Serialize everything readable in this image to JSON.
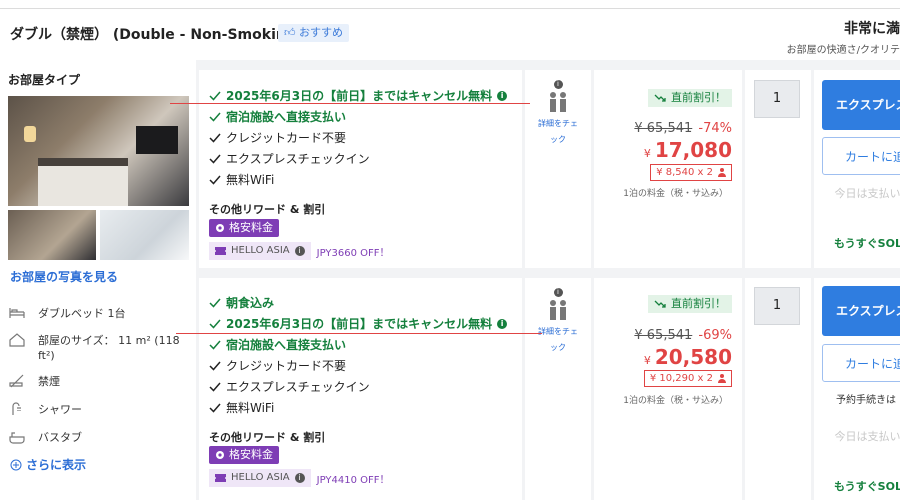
{
  "room": {
    "title": "ダブル（禁煙） (Double - Non-Smoking)",
    "badge": "おすすめ"
  },
  "header_right": {
    "heading": "非常に満",
    "subtitle": "お部屋の快適さ/クオリテ"
  },
  "left_panel": {
    "title": "お部屋タイプ",
    "photos_link": "お部屋の写真を見る",
    "amenities": [
      {
        "icon": "bed-icon",
        "text": "ダブルベッド 1台"
      },
      {
        "icon": "room-size-icon",
        "text": "部屋のサイズ： 11 m² (118 ft²)"
      },
      {
        "icon": "no-smoking-icon",
        "text": "禁煙"
      },
      {
        "icon": "shower-icon",
        "text": "シャワー"
      },
      {
        "icon": "bathtub-icon",
        "text": "バスタブ"
      }
    ],
    "more_link": "さらに表示"
  },
  "offers": [
    {
      "features": [
        {
          "text": "2025年6月3日の【前日】まではキャンセル無料",
          "green": true,
          "info": true
        },
        {
          "text": "宿泊施設へ直接支払い",
          "green": true,
          "info": false
        },
        {
          "text": "クレジットカード不要",
          "green": false,
          "info": false
        },
        {
          "text": "エクスプレスチェックイン",
          "green": false,
          "info": false
        },
        {
          "text": "無料WiFi",
          "green": false,
          "info": false
        }
      ],
      "rewards_title": "その他リワード & 割引",
      "tag": "格安料金",
      "promo_name": "HELLO ASIA",
      "promo_discount": "JPY3660 OFF！",
      "details_link": "詳細をチェック",
      "deal_badge": "直前割引！",
      "original_price": "¥ 65,541",
      "discount_pct": "-74%",
      "currency": "¥",
      "price": "17,080",
      "per_night": "¥ 8,540 x 2",
      "price_note": "1泊の料金（税・サ込み）",
      "quantity": "1",
      "express_button": "エクスプレス",
      "cart_button": "カートに追",
      "pre_note": "",
      "no_payment": "今日は支払い要",
      "sold_out_soon": "もうすぐSOL"
    },
    {
      "features": [
        {
          "text": "朝食込み",
          "green": true,
          "info": false
        },
        {
          "text": "2025年6月3日の【前日】まではキャンセル無料",
          "green": true,
          "info": true
        },
        {
          "text": "宿泊施設へ直接支払い",
          "green": true,
          "info": false
        },
        {
          "text": "クレジットカード不要",
          "green": false,
          "info": false
        },
        {
          "text": "エクスプレスチェックイン",
          "green": false,
          "info": false
        },
        {
          "text": "無料WiFi",
          "green": false,
          "info": false
        }
      ],
      "rewards_title": "その他リワード & 割引",
      "tag": "格安料金",
      "promo_name": "HELLO ASIA",
      "promo_discount": "JPY4410 OFF！",
      "details_link": "詳細をチェック",
      "deal_badge": "直前割引！",
      "original_price": "¥ 65,541",
      "discount_pct": "-69%",
      "currency": "¥",
      "price": "20,580",
      "per_night": "¥ 10,290 x 2",
      "price_note": "1泊の料金（税・サ込み）",
      "quantity": "1",
      "express_button": "エクスプレス",
      "cart_button": "カートに追",
      "pre_note": "予約手続きは",
      "no_payment": "今日は支払い要",
      "sold_out_soon": "もうすぐSOL"
    }
  ],
  "colors": {
    "accent_blue": "#2f7de0",
    "price_red": "#e04444",
    "green": "#15803d",
    "purple": "#7e3db5"
  }
}
